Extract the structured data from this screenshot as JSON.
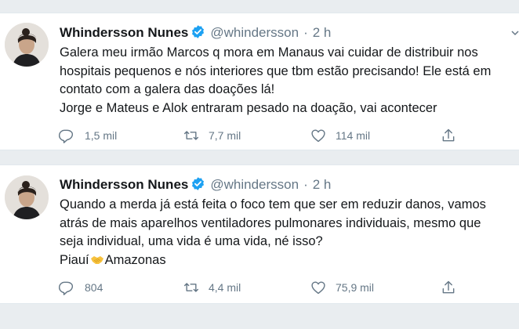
{
  "tweets": [
    {
      "name": "Whindersson Nunes",
      "handle": "@whindersson",
      "time": "2 h",
      "lines": [
        "Galera meu irmão Marcos q mora em Manaus vai cuidar de distribuir nos",
        "hospitais pequenos e nós interiores que tbm estão precisando! Ele está em",
        "contato com a galera das doações lá!",
        "Jorge e Mateus e Alok entraram pesado na doação, vai acontecer"
      ],
      "replies": "1,5 mil",
      "retweets": "7,7 mil",
      "likes": "114 mil"
    },
    {
      "name": "Whindersson Nunes",
      "handle": "@whindersson",
      "time": "2 h",
      "lines": [
        "Quando a merda já está feita o foco tem que ser em reduzir danos, vamos",
        "atrás de mais aparelhos ventiladores pulmonares individuais, mesmo que",
        "seja individual, uma vida é uma vida, né isso?"
      ],
      "last_line_start": "Piauí",
      "last_line_end": "Amazonas",
      "replies": "804",
      "retweets": "4,4 mil",
      "likes": "75,9 mil"
    }
  ],
  "icons": {
    "verified": "verified-badge-icon",
    "reply": "reply-icon",
    "retweet": "retweet-icon",
    "like": "heart-icon",
    "share": "share-icon",
    "caret": "chevron-down-icon",
    "emoji": "handshake-emoji-icon"
  },
  "colors": {
    "verified": "#1da1f2",
    "text": "#14171a",
    "secondary": "#657786",
    "background": "#e9edf0",
    "emoji": "#f7c23e"
  }
}
